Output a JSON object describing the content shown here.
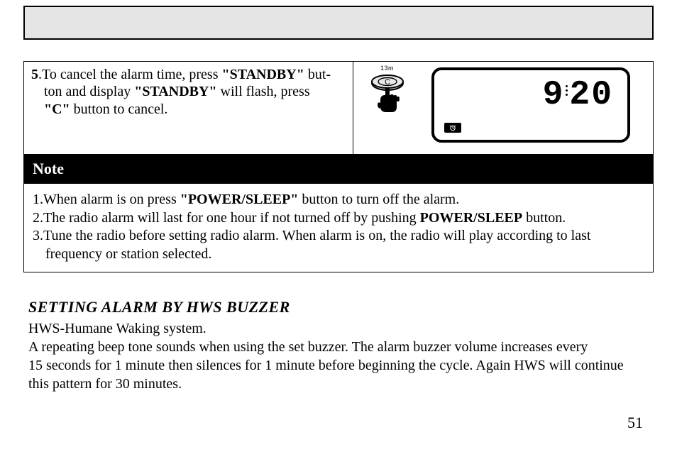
{
  "step": {
    "number": "5",
    "line1_a": ".To cancel the alarm time, press ",
    "line1_b": "\"STANDBY\"",
    "line1_c": " but-",
    "line2_a": "ton and display ",
    "line2_b": "\"STANDBY\"",
    "line2_c": " will flash, press",
    "line3_a": "\"C\"",
    "line3_b": " button to cancel."
  },
  "illustration": {
    "label": "13m",
    "button_letter": "C",
    "time_hour": "9",
    "time_minute": "20"
  },
  "note": {
    "header": "Note",
    "items": [
      {
        "prefix": "1.When alarm is on press ",
        "bold": "\"POWER/SLEEP\"",
        "suffix": " button to turn off the alarm."
      },
      {
        "prefix": "2.The radio alarm will last for one hour if not turned off by pushing ",
        "bold": "POWER/SLEEP",
        "suffix": " button."
      },
      {
        "prefix": "3.Tune the radio before setting radio alarm. When alarm is on, the radio will play according to last",
        "bold": "",
        "suffix": "",
        "cont": "frequency or station selected."
      }
    ]
  },
  "section": {
    "title": "SETTING ALARM BY HWS BUZZER",
    "body1": "HWS-Humane Waking system.",
    "body2": "A repeating beep tone sounds when using the set buzzer. The alarm buzzer volume increases every",
    "body3": "15 seconds for 1 minute then silences for 1 minute before beginning the cycle. Again HWS will continue",
    "body4": "this pattern for 30 minutes."
  },
  "page_number": "51"
}
